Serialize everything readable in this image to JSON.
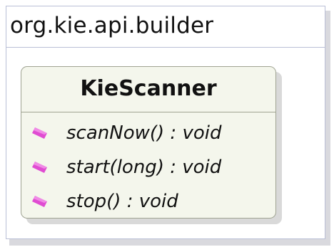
{
  "package": {
    "name": "org.kie.api.builder"
  },
  "class": {
    "name": "KieScanner",
    "methods": [
      {
        "signature": "scanNow() : void",
        "visibility_icon": "public-method-icon"
      },
      {
        "signature": "start(long) : void",
        "visibility_icon": "public-method-icon"
      },
      {
        "signature": "stop() : void",
        "visibility_icon": "public-method-icon"
      }
    ]
  },
  "colors": {
    "package_border": "#b9bfd6",
    "class_fill": "#f4f6ec",
    "class_border": "#9fa392",
    "method_icon": "#e04cd2"
  }
}
